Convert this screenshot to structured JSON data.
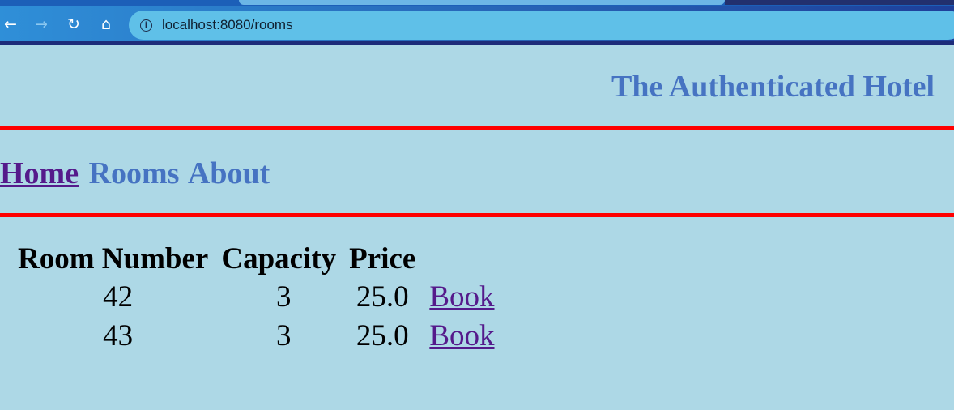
{
  "browser": {
    "url": "localhost:8080/rooms",
    "back_icon": "arrow-left-icon",
    "forward_icon": "arrow-right-icon",
    "reload_icon": "reload-icon",
    "home_icon": "home-icon",
    "site_info_icon": "info-icon"
  },
  "header": {
    "title": "The Authenticated Hotel"
  },
  "nav": {
    "items": [
      {
        "label": "Home"
      },
      {
        "label": "Rooms"
      },
      {
        "label": "About"
      }
    ]
  },
  "rooms_table": {
    "headers": [
      "Room Number",
      "Capacity",
      "Price"
    ],
    "rows": [
      {
        "room_number": "42",
        "capacity": "3",
        "price": "25.0",
        "action": "Book"
      },
      {
        "room_number": "43",
        "capacity": "3",
        "price": "25.0",
        "action": "Book"
      }
    ]
  },
  "colors": {
    "page_background": "#add8e6",
    "title_color": "#4673c2",
    "rule_color": "#ff0000",
    "visited_link": "#551a8b"
  }
}
